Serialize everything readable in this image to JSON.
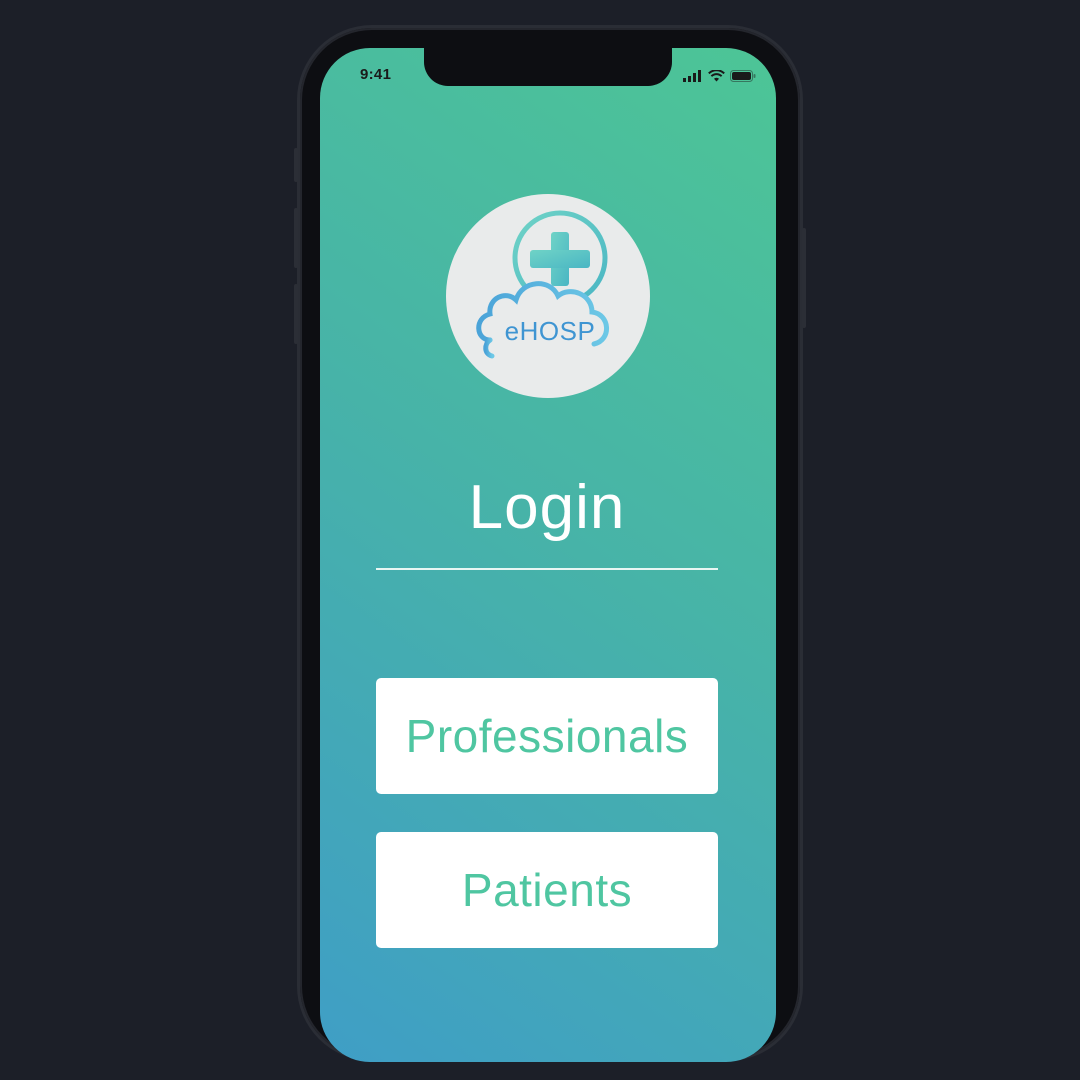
{
  "status_bar": {
    "time": "9:41",
    "icons": [
      "signal-icon",
      "wifi-icon",
      "battery-icon"
    ]
  },
  "logo": {
    "text": "eHOSP",
    "icon": "cross-cloud-logo-icon"
  },
  "login": {
    "title": "Login"
  },
  "buttons": {
    "professionals_label": "Professionals",
    "patients_label": "Patients"
  },
  "colors": {
    "gradient_top": "#4dc596",
    "gradient_bottom": "#3f9ec6",
    "button_text": "#4fc6a1",
    "background": "#1c1f28"
  }
}
